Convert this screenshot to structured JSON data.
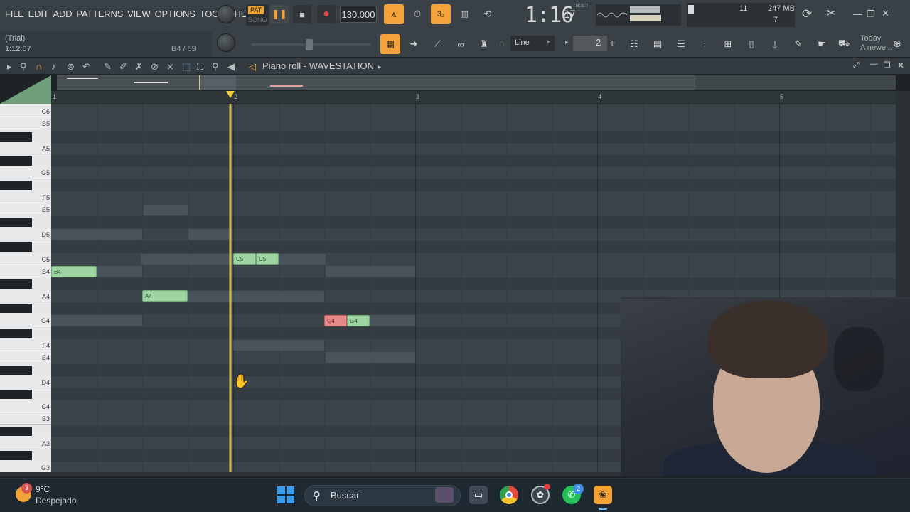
{
  "menu": [
    "FILE",
    "EDIT",
    "ADD",
    "PATTERNS",
    "VIEW",
    "OPTIONS",
    "TOOLS",
    "HELP"
  ],
  "hint": {
    "trial": "(Trial)",
    "time": "1:12:07",
    "note": "B4 / 59"
  },
  "transport": {
    "pat": "PAT",
    "song": "SONG",
    "tempo": "130.000"
  },
  "time_display": {
    "main": "1:16",
    "small": "17",
    "label": "B:S:T"
  },
  "memory": {
    "cpu": "11",
    "ram": "247 MB",
    "polyphony": "7"
  },
  "snap": {
    "value": "Line"
  },
  "pattern_number": "2",
  "news": {
    "line1": "Today",
    "line2": "A newe..."
  },
  "piano_roll": {
    "title": "Piano roll - WAVESTATION",
    "bars": [
      "1",
      "2",
      "3",
      "4",
      "5"
    ],
    "keys": [
      "C6",
      "B5",
      "A5",
      "G5",
      "F5",
      "E5",
      "D5",
      "C5",
      "B4",
      "A4",
      "G4",
      "F4",
      "E4",
      "D4",
      "C4",
      "B3",
      "A3",
      "G3"
    ],
    "notes": [
      {
        "label": "B4",
        "color": "green"
      },
      {
        "label": "A4",
        "color": "green"
      },
      {
        "label": "C5",
        "color": "green"
      },
      {
        "label": "C5",
        "color": "green"
      },
      {
        "label": "G4",
        "color": "red"
      },
      {
        "label": "G4",
        "color": "green"
      }
    ]
  },
  "taskbar": {
    "weather_badge": "3",
    "temperature": "9°C",
    "weather": "Despejado",
    "search_placeholder": "Buscar",
    "whatsapp_badge": "2"
  },
  "colors": {
    "accent": "#f3a23c",
    "note_green": "#9fd4a2",
    "note_red": "#e68a89",
    "playhead": "#f0d84a"
  }
}
